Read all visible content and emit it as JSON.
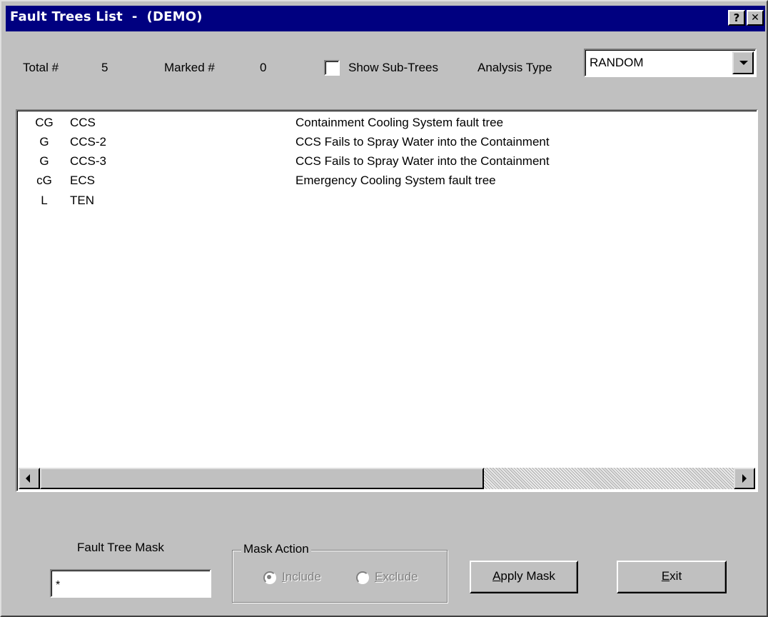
{
  "window": {
    "title": "Fault Trees List  -  (DEMO)",
    "help_button": "?",
    "close_button": "✕"
  },
  "header": {
    "total_label": "Total #",
    "total_value": "5",
    "marked_label": "Marked #",
    "marked_value": "0",
    "show_subtrees_label": "Show Sub-Trees",
    "show_subtrees_checked": false,
    "analysis_type_label": "Analysis Type",
    "analysis_type_value": "RANDOM"
  },
  "list": {
    "rows": [
      {
        "flag": "CG",
        "name": "CCS",
        "description": "Containment Cooling System fault tree"
      },
      {
        "flag": "G",
        "name": "CCS-2",
        "description": "CCS Fails to Spray Water into the Containment"
      },
      {
        "flag": "G",
        "name": "CCS-3",
        "description": "CCS Fails to Spray Water into the Containment"
      },
      {
        "flag": "cG",
        "name": "ECS",
        "description": "Emergency Cooling System fault tree"
      },
      {
        "flag": "L",
        "name": "TEN",
        "description": ""
      }
    ],
    "scroll_position": 0.63
  },
  "footer": {
    "mask_label": "Fault Tree Mask",
    "mask_value": "*",
    "mask_action_legend": "Mask Action",
    "include_label": "Include",
    "exclude_label": "Exclude",
    "include_selected": true,
    "apply_mask_label": "Apply Mask",
    "exit_label": "Exit"
  },
  "colors": {
    "face": "#c0c0c0",
    "titlebar": "#000080",
    "disabled_text": "#808080"
  }
}
